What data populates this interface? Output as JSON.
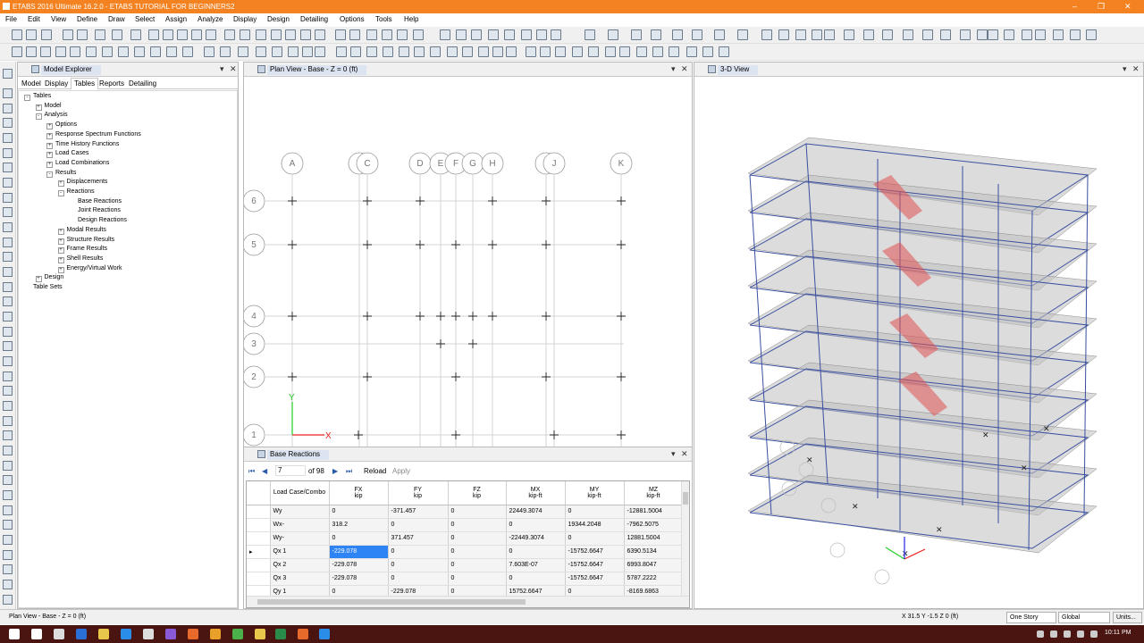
{
  "window": {
    "title": "ETABS 2016 Ultimate 16.2.0 - ETABS TUTORIAL FOR BEGINNERS2"
  },
  "menu": [
    "File",
    "Edit",
    "View",
    "Define",
    "Draw",
    "Select",
    "Assign",
    "Analyze",
    "Display",
    "Design",
    "Detailing",
    "Options",
    "Tools",
    "Help"
  ],
  "model_explorer": {
    "title": "Model Explorer",
    "tabs": [
      "Model",
      "Display",
      "Tables",
      "Reports",
      "Detailing"
    ],
    "active_tab": "Tables",
    "tree": [
      {
        "label": "Tables",
        "level": 0,
        "box": "-"
      },
      {
        "label": "Model",
        "level": 1,
        "box": "+"
      },
      {
        "label": "Analysis",
        "level": 1,
        "box": "-"
      },
      {
        "label": "Options",
        "level": 2,
        "box": "+"
      },
      {
        "label": "Response Spectrum Functions",
        "level": 2,
        "box": "+"
      },
      {
        "label": "Time History Functions",
        "level": 2,
        "box": "+"
      },
      {
        "label": "Load Cases",
        "level": 2,
        "box": "+"
      },
      {
        "label": "Load Combinations",
        "level": 2,
        "box": "+"
      },
      {
        "label": "Results",
        "level": 2,
        "box": "-"
      },
      {
        "label": "Displacements",
        "level": 3,
        "box": "+"
      },
      {
        "label": "Reactions",
        "level": 3,
        "box": "-"
      },
      {
        "label": "Base Reactions",
        "level": 4,
        "box": ""
      },
      {
        "label": "Joint Reactions",
        "level": 4,
        "box": ""
      },
      {
        "label": "Design Reactions",
        "level": 4,
        "box": ""
      },
      {
        "label": "Modal Results",
        "level": 3,
        "box": "+"
      },
      {
        "label": "Structure Results",
        "level": 3,
        "box": "+"
      },
      {
        "label": "Frame Results",
        "level": 3,
        "box": "+"
      },
      {
        "label": "Shell Results",
        "level": 3,
        "box": "+"
      },
      {
        "label": "Energy/Virtual Work",
        "level": 3,
        "box": "+"
      },
      {
        "label": "Design",
        "level": 1,
        "box": "+"
      },
      {
        "label": "Table Sets",
        "level": 0,
        "box": ""
      }
    ]
  },
  "plan_view": {
    "title": "Plan View - Base - Z = 0 (ft)",
    "grid_x": [
      "A",
      "B",
      "C",
      "D",
      "E",
      "F",
      "G",
      "H",
      "I",
      "J",
      "K"
    ],
    "grid_y": [
      "6",
      "5",
      "4",
      "3",
      "2",
      "1"
    ],
    "axis_x": "X",
    "axis_y": "Y"
  },
  "base_reactions": {
    "title": "Base Reactions",
    "record": "7",
    "of_label": "of 98",
    "reload_label": "Reload",
    "apply_label": "Apply",
    "columns": [
      {
        "name": "Load Case/Combo",
        "unit": ""
      },
      {
        "name": "FX",
        "unit": "kip"
      },
      {
        "name": "FY",
        "unit": "kip"
      },
      {
        "name": "FZ",
        "unit": "kip"
      },
      {
        "name": "MX",
        "unit": "kip-ft"
      },
      {
        "name": "MY",
        "unit": "kip-ft"
      },
      {
        "name": "MZ",
        "unit": "kip-ft"
      }
    ],
    "rows": [
      [
        "Wy",
        "0",
        "-371.457",
        "0",
        "22449.3074",
        "0",
        "-12881.5004"
      ],
      [
        "Wx-",
        "318.2",
        "0",
        "0",
        "0",
        "19344.2048",
        "-7962.5075"
      ],
      [
        "Wy-",
        "0",
        "371.457",
        "0",
        "-22449.3074",
        "0",
        "12881.5004"
      ],
      [
        "Qx 1",
        "-229.078",
        "0",
        "0",
        "0",
        "-15752.6647",
        "6390.5134"
      ],
      [
        "Qx 2",
        "-229.078",
        "0",
        "0",
        "7.603E-07",
        "-15752.6647",
        "6993.8047"
      ],
      [
        "Qx 3",
        "-229.078",
        "0",
        "0",
        "0",
        "-15752.6647",
        "5787.2222"
      ],
      [
        "Qy 1",
        "0",
        "-229.078",
        "0",
        "15752.6647",
        "0",
        "-8169.6863"
      ]
    ],
    "selected_row": 3
  },
  "view_3d": {
    "title": "3-D View"
  },
  "status": {
    "left": "Plan View - Base - Z = 0 (ft)",
    "coords": "X 31.5  Y -1.5  Z 0 (ft)",
    "story": "One Story",
    "csys": "Global",
    "units": "Units..."
  },
  "taskbar": {
    "time": "10:11 PM"
  },
  "colors": {
    "titlebar": "#f48220",
    "selection": "#2f84f5",
    "frame": "#3a4fa0",
    "brace": "#e05050"
  }
}
